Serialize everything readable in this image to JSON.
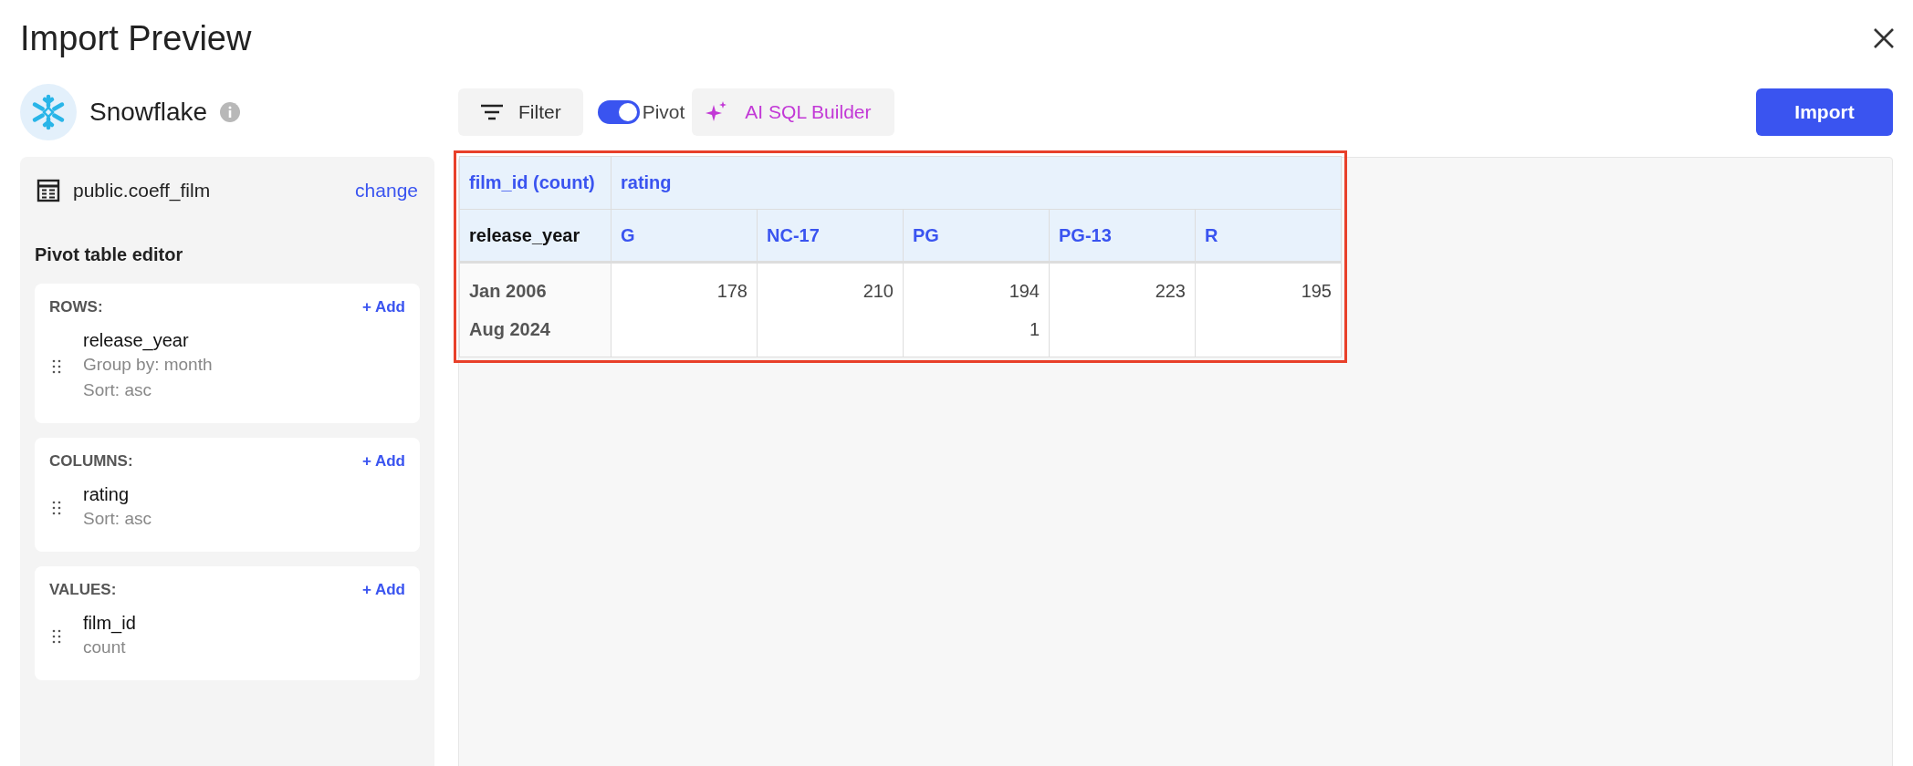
{
  "window": {
    "title": "Import Preview"
  },
  "source": {
    "name": "Snowflake"
  },
  "toolbar": {
    "filter": "Filter",
    "pivot": {
      "label": "Pivot",
      "on": true
    },
    "ai_builder": "AI SQL Builder",
    "import": "Import"
  },
  "sidebar": {
    "table_name": "public.coeff_film",
    "change": "change",
    "editor_title": "Pivot table editor",
    "sections": [
      {
        "title": "ROWS:",
        "add": "+ Add",
        "fields": [
          {
            "name": "release_year",
            "details": [
              "Group by: month",
              "Sort: asc"
            ]
          }
        ]
      },
      {
        "title": "COLUMNS:",
        "add": "+ Add",
        "fields": [
          {
            "name": "rating",
            "details": [
              "Sort: asc"
            ]
          }
        ]
      },
      {
        "title": "VALUES:",
        "add": "+ Add",
        "fields": [
          {
            "name": "film_id",
            "details": [
              "count"
            ]
          }
        ]
      }
    ]
  },
  "pivot_table": {
    "highlighted": true,
    "value_header": "film_id (count)",
    "column_header": "rating",
    "row_header": "release_year",
    "columns": [
      "G",
      "NC-17",
      "PG",
      "PG-13",
      "R"
    ],
    "rows": [
      {
        "label": "Jan 2006",
        "cells": [
          "178",
          "210",
          "194",
          "223",
          "195"
        ]
      },
      {
        "label": "Aug 2024",
        "cells": [
          "",
          "",
          "1",
          "",
          ""
        ]
      }
    ]
  }
}
